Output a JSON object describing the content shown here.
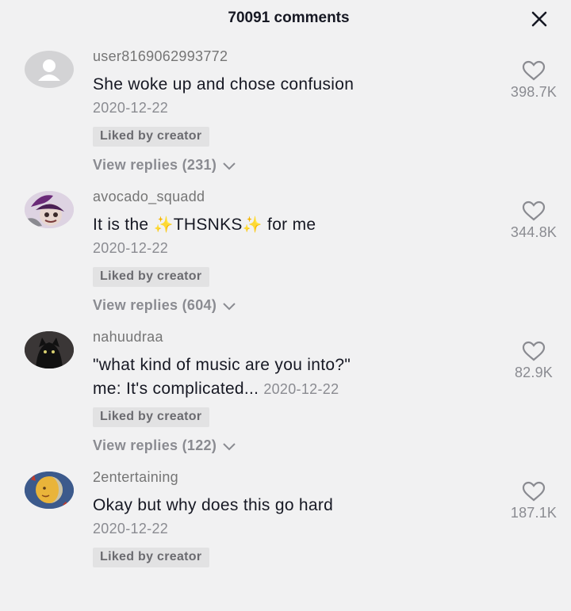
{
  "header": {
    "title": "70091 comments",
    "close_icon": "close-icon"
  },
  "colors": {
    "background": "#f1f1f2",
    "text": "#161823",
    "muted": "#8a8b91",
    "badge_bg": "#e2e2e3"
  },
  "comments": [
    {
      "username": "user8169062993772",
      "text": "She woke up and chose confusion",
      "date": "2020-12-22",
      "badge": "Liked by creator",
      "replies": "View replies (231)",
      "likes": "398.7K",
      "avatar": "default-user-avatar"
    },
    {
      "username": "avocado_squadd",
      "text_before": "It is the ",
      "sparkle": "✨",
      "text_highlight": "THSNKS",
      "text_after": " for me",
      "date": "2020-12-22",
      "badge": "Liked by creator",
      "replies": "View replies (604)",
      "likes": "344.8K",
      "avatar": "cartoon-avatar"
    },
    {
      "username": "nahuudraa",
      "text_line1": "\"what kind of music are you into?\"",
      "text_line2": "me: It's complicated...",
      "date": "2020-12-22",
      "badge": "Liked by creator",
      "replies": "View replies (122)",
      "likes": "82.9K",
      "avatar": "dark-cat-avatar"
    },
    {
      "username": "2entertaining",
      "text": "Okay but why does this go hard",
      "date": "2020-12-22",
      "badge": "Liked by creator",
      "likes": "187.1K",
      "avatar": "sun-moon-avatar"
    }
  ]
}
